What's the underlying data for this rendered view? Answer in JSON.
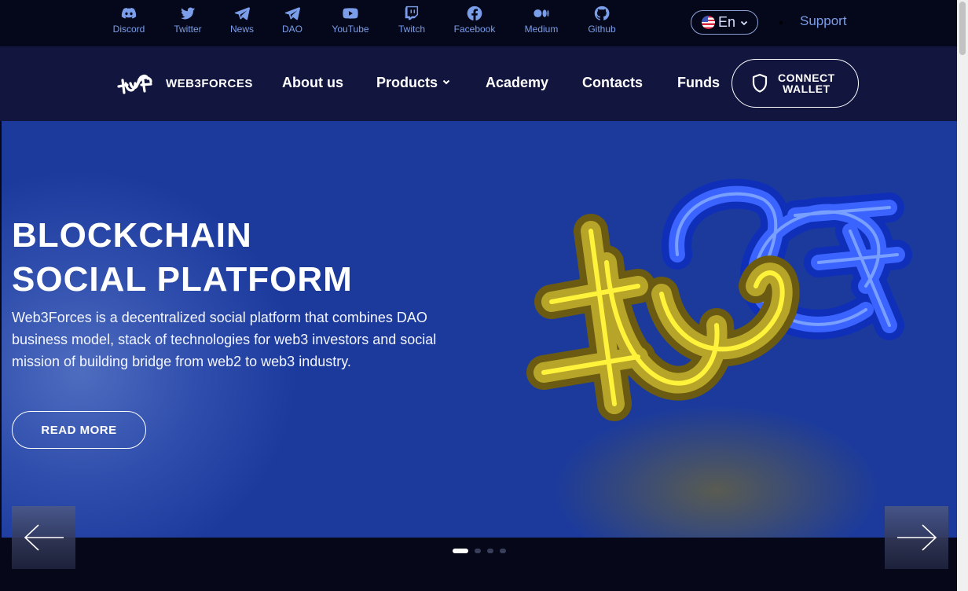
{
  "topbar": {
    "social": [
      {
        "label": "Discord",
        "icon": "discord-icon"
      },
      {
        "label": "Twitter",
        "icon": "twitter-icon"
      },
      {
        "label": "News",
        "icon": "telegram-icon"
      },
      {
        "label": "DAO",
        "icon": "telegram-icon"
      },
      {
        "label": "YouTube",
        "icon": "youtube-icon"
      },
      {
        "label": "Twitch",
        "icon": "twitch-icon"
      },
      {
        "label": "Facebook",
        "icon": "facebook-icon"
      },
      {
        "label": "Medium",
        "icon": "medium-icon"
      },
      {
        "label": "Github",
        "icon": "github-icon"
      }
    ],
    "language": "En",
    "support": "Support"
  },
  "nav": {
    "brand": "WEB3FORCES",
    "items": [
      "About us",
      "Products",
      "Academy",
      "Contacts",
      "Funds"
    ],
    "connect_line1": "CONNECT",
    "connect_line2": "WALLET"
  },
  "hero": {
    "title_line1": "BLOCKCHAIN",
    "title_line2": "SOCIAL PLATFORM",
    "description": "Web3Forces is a decentralized social platform that combines DAO business model, stack of technologies for web3 investors and social mission of building bridge from web2 to web3 industry.",
    "cta": "READ MORE"
  },
  "slider": {
    "total": 4,
    "active": 1
  },
  "colors": {
    "accent": "#7b9eea",
    "hero_bg": "#1b3a9c",
    "nav_bg": "#12163f",
    "topbar_bg": "#05081a"
  }
}
